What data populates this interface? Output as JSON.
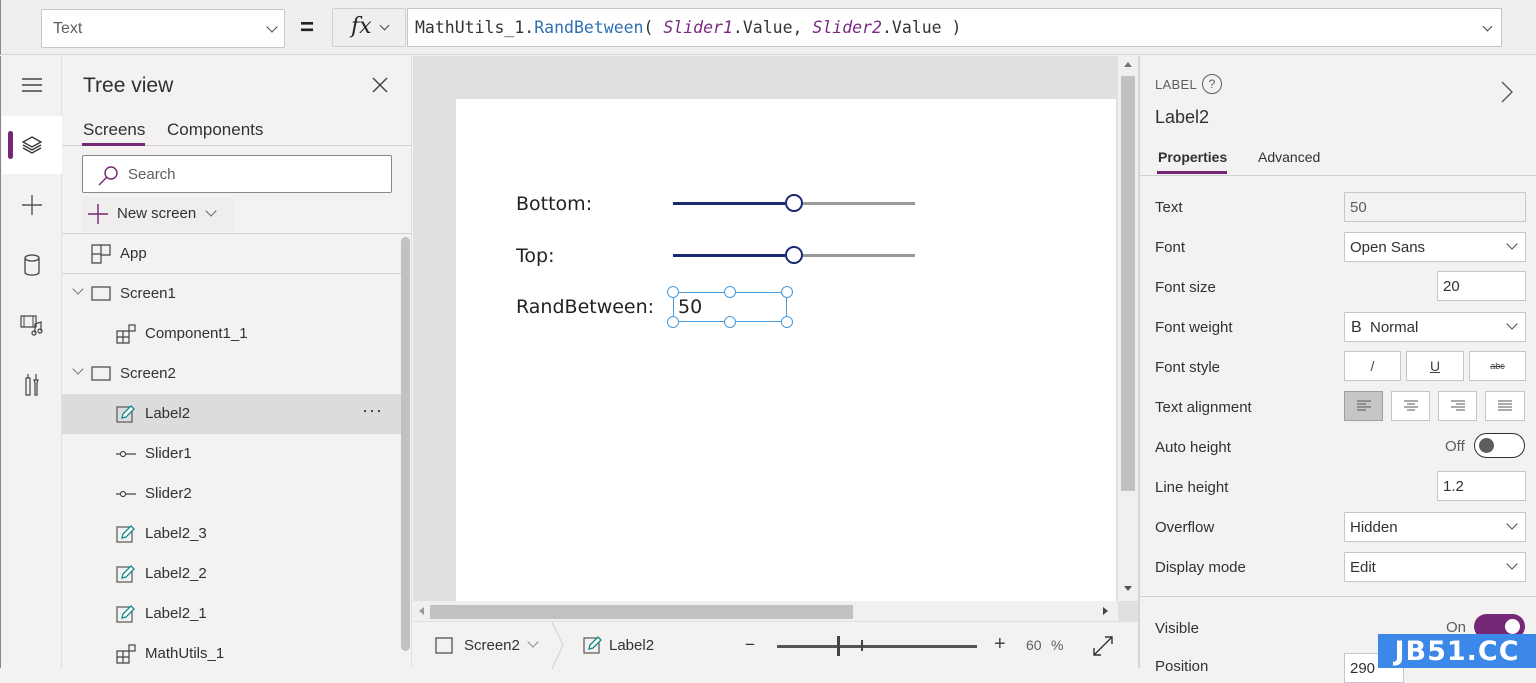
{
  "formula_bar": {
    "property": "Text",
    "equals": "=",
    "fx_label": "fx",
    "formula": {
      "object": "MathUtils_1.",
      "function": "RandBetween",
      "open": "( ",
      "arg1_control": "Slider1",
      "arg1_prop": ".Value, ",
      "arg2_control": "Slider2",
      "arg2_prop": ".Value )"
    }
  },
  "left_rail": {
    "items": [
      {
        "icon": "hamburger-menu-icon"
      },
      {
        "icon": "layers-icon",
        "active": true
      },
      {
        "icon": "plus-icon"
      },
      {
        "icon": "database-icon"
      },
      {
        "icon": "media-icon"
      },
      {
        "icon": "tools-icon"
      }
    ]
  },
  "tree_view": {
    "title": "Tree view",
    "tabs": [
      {
        "label": "Screens",
        "active": true
      },
      {
        "label": "Components",
        "active": false
      }
    ],
    "search_placeholder": "Search",
    "new_screen_label": "New screen",
    "more_label": "···",
    "items": [
      {
        "label": "App",
        "icon": "app-icon",
        "level": 0
      },
      {
        "label": "Screen1",
        "icon": "screen-icon",
        "level": 0,
        "expanded": true
      },
      {
        "label": "Component1_1",
        "icon": "component-icon",
        "level": 1
      },
      {
        "label": "Screen2",
        "icon": "screen-icon",
        "level": 0,
        "expanded": true
      },
      {
        "label": "Label2",
        "icon": "label-icon",
        "level": 1,
        "selected": true
      },
      {
        "label": "Slider1",
        "icon": "slider-icon",
        "level": 1
      },
      {
        "label": "Slider2",
        "icon": "slider-icon",
        "level": 1
      },
      {
        "label": "Label2_3",
        "icon": "label-icon",
        "level": 1
      },
      {
        "label": "Label2_2",
        "icon": "label-icon",
        "level": 1
      },
      {
        "label": "Label2_1",
        "icon": "label-icon",
        "level": 1
      },
      {
        "label": "MathUtils_1",
        "icon": "component-icon",
        "level": 1
      }
    ]
  },
  "canvas": {
    "labels": {
      "bottom": "Bottom:",
      "top": "Top:",
      "randbetween": "RandBetween:"
    },
    "sliders": [
      {
        "name": "Slider1",
        "value_fraction": 0.5
      },
      {
        "name": "Slider2",
        "value_fraction": 0.5
      }
    ],
    "selected_label_value": "50"
  },
  "status_bar": {
    "screen": "Screen2",
    "control": "Label2",
    "zoom_minus": "−",
    "zoom_plus": "+",
    "zoom_value": "60",
    "zoom_unit": "%",
    "zoom_fraction": 0.3
  },
  "properties": {
    "control_type": "LABEL",
    "help": "?",
    "control_name": "Label2",
    "tabs": [
      {
        "label": "Properties",
        "active": true
      },
      {
        "label": "Advanced",
        "active": false
      }
    ],
    "rows": {
      "text": {
        "label": "Text",
        "value": "50"
      },
      "font": {
        "label": "Font",
        "value": "Open Sans"
      },
      "font_size": {
        "label": "Font size",
        "value": "20"
      },
      "font_weight": {
        "label": "Font weight",
        "prefix": "B",
        "value": "Normal"
      },
      "font_style": {
        "label": "Font style",
        "italic": "/",
        "underline": "U",
        "strike": "abc"
      },
      "text_alignment": {
        "label": "Text alignment",
        "selected": "left"
      },
      "auto_height": {
        "label": "Auto height",
        "state": "Off"
      },
      "line_height": {
        "label": "Line height",
        "value": "1.2"
      },
      "overflow": {
        "label": "Overflow",
        "value": "Hidden"
      },
      "display_mode": {
        "label": "Display mode",
        "value": "Edit"
      },
      "visible": {
        "label": "Visible",
        "state": "On"
      },
      "position": {
        "label": "Position",
        "value": "290"
      }
    }
  },
  "watermark": "JB51.CC",
  "colors": {
    "accent": "#742774",
    "slider": "#1b2a70",
    "selection": "#4a9bdc",
    "label_icon": "#0b8a8a"
  }
}
